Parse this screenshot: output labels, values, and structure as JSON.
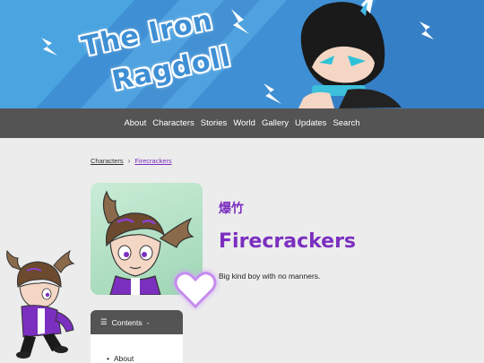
{
  "site": {
    "logo_line1": "The Iron",
    "logo_line2": "Ragdoll"
  },
  "nav": {
    "items": [
      "About",
      "Characters",
      "Stories",
      "World",
      "Gallery",
      "Updates",
      "Search"
    ]
  },
  "breadcrumb": {
    "parent": "Characters",
    "current": "Firecrackers"
  },
  "character": {
    "cjk_name": "爆竹",
    "name": "Firecrackers",
    "description": "Big kind boy with no manners."
  },
  "contents": {
    "title": "Contents",
    "items": [
      "About"
    ]
  },
  "colors": {
    "accent": "#7b2fbf",
    "banner_blue": "#3f8fd4",
    "nav_bg": "#545454",
    "page_bg": "#ececec"
  }
}
